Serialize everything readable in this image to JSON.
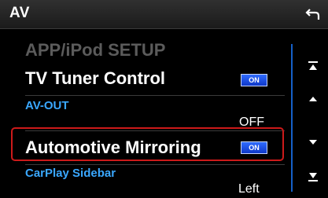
{
  "header": {
    "title": "AV"
  },
  "list": {
    "items": [
      {
        "label": "APP/iPod SETUP"
      },
      {
        "label": "TV Tuner Control",
        "badge": "ON"
      },
      {
        "label": "AV-OUT",
        "value": "OFF"
      },
      {
        "label": "Automotive Mirroring",
        "badge": "ON"
      },
      {
        "label": "CarPlay Sidebar",
        "value": "Left"
      }
    ]
  },
  "icons": {
    "back": "back-arrow-icon",
    "scroll_top": "scroll-to-top-icon",
    "scroll_up": "scroll-up-icon",
    "scroll_down": "scroll-down-icon",
    "scroll_bottom": "scroll-to-bottom-icon"
  },
  "colors": {
    "accent": "#3aa8ff",
    "badge": "#1f55e0",
    "highlight": "#cc1a1a"
  }
}
